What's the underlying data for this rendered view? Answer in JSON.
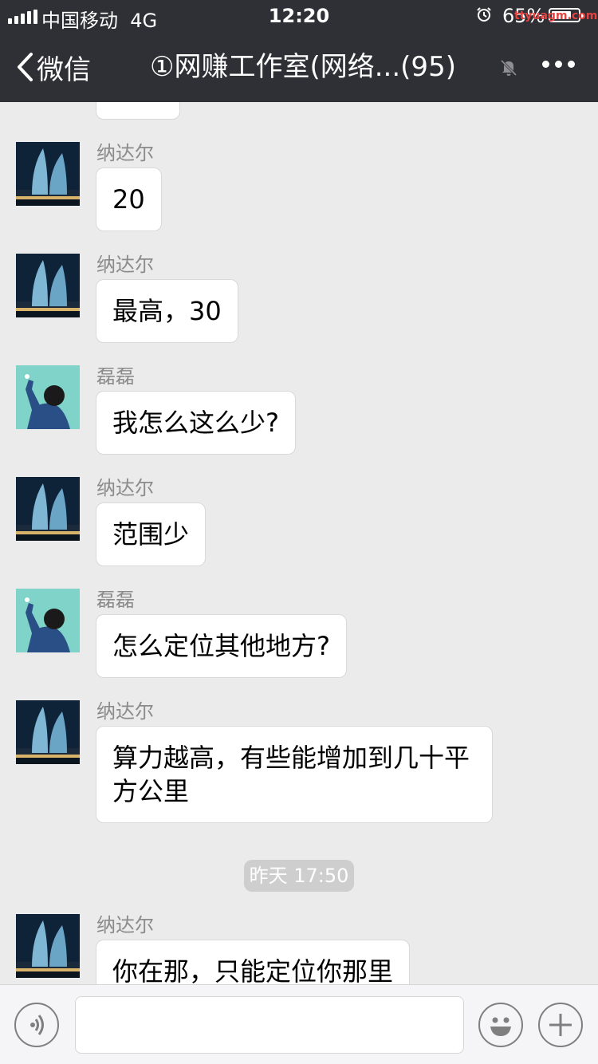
{
  "status_bar": {
    "carrier": "中国移动",
    "network": "4G",
    "time": "12:20",
    "battery": "65%",
    "watermark": "ttyuagm.com",
    "icons": [
      "signal-icon",
      "alarm-icon",
      "battery-icon"
    ]
  },
  "nav": {
    "back_label": "微信",
    "title": "①网赚工作室(网络...(95)",
    "icons": [
      "chevron-left-icon",
      "mute-icon",
      "more-icon"
    ]
  },
  "messages": [
    {
      "sender": "纳达尔",
      "text": "20",
      "avatar": "building-avatar"
    },
    {
      "sender": "纳达尔",
      "text": "最高，30",
      "avatar": "building-avatar"
    },
    {
      "sender": "磊磊",
      "text": "我怎么这么少?",
      "avatar": "person-avatar"
    },
    {
      "sender": "纳达尔",
      "text": "范围少",
      "avatar": "building-avatar"
    },
    {
      "sender": "磊磊",
      "text": "怎么定位其他地方?",
      "avatar": "person-avatar"
    },
    {
      "sender": "纳达尔",
      "text": "算力越高，有些能增加到几十平方公里",
      "avatar": "building-avatar"
    },
    {
      "sender": "纳达尔",
      "text": "你在那，只能定位你那里",
      "avatar": "building-avatar"
    }
  ],
  "timestamp": "昨天 17:50",
  "input_bar": {
    "icons": [
      "voice-icon",
      "emoji-icon",
      "plus-icon"
    ]
  },
  "colors": {
    "header_bg": "#2f2f36",
    "chat_bg": "#ebebeb",
    "bubble_bg": "#ffffff",
    "time_pill_bg": "#cecece"
  }
}
